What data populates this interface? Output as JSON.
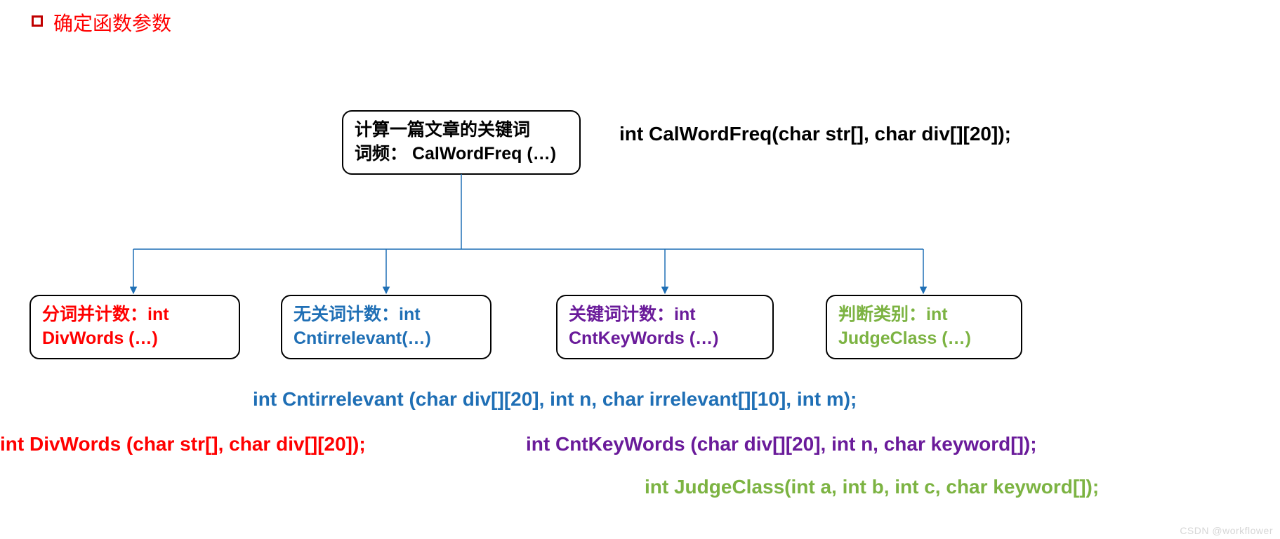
{
  "title": "确定函数参数",
  "root": {
    "label_line1": "计算一篇文章的关键词",
    "label_line2": "词频：  CalWordFreq (…)",
    "signature": "int CalWordFreq(char str[], char div[][20]);"
  },
  "children": [
    {
      "label_line1": "分词并计数：int",
      "label_line2": "DivWords (…)",
      "color": "red",
      "signature": "int DivWords (char str[], char div[][20]);"
    },
    {
      "label_line1": "无关词计数：int",
      "label_line2": "Cntirrelevant(…)",
      "color": "blue",
      "signature": "int Cntirrelevant (char div[][20], int n, char irrelevant[][10], int m);"
    },
    {
      "label_line1": "关键词计数：int",
      "label_line2": "CntKeyWords (…)",
      "color": "purple",
      "signature": "int CntKeyWords (char div[][20], int n, char keyword[]);"
    },
    {
      "label_line1": "判断类别：int",
      "label_line2": "JudgeClass (…)",
      "color": "green",
      "signature": "int JudgeClass(int a, int b, int c, char keyword[]);"
    }
  ],
  "watermark": "CSDN @workflower"
}
